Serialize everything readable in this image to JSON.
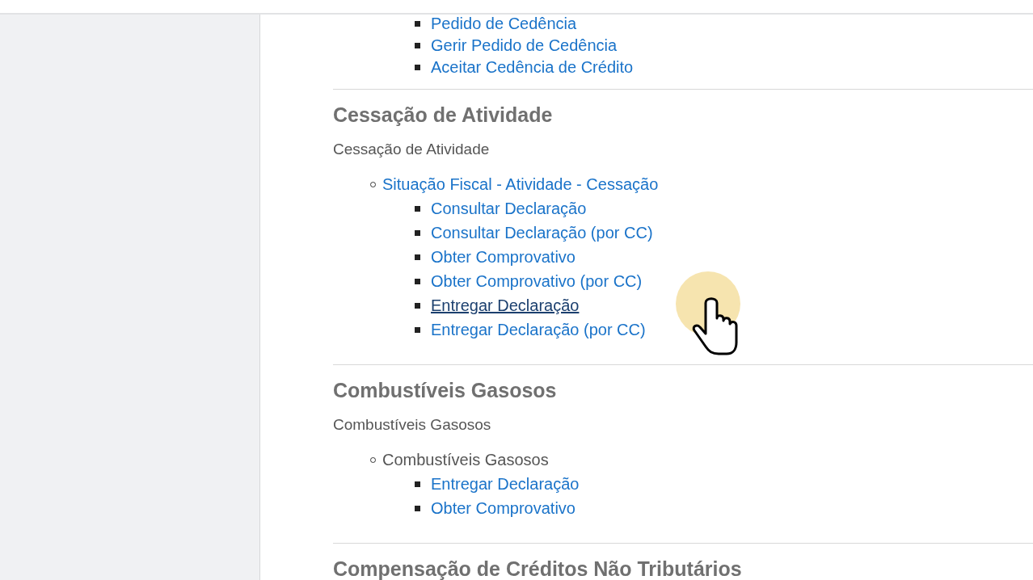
{
  "top_links": [
    {
      "label": "Pedido de Cedência",
      "hovered": false
    },
    {
      "label": "Gerir Pedido de Cedência",
      "hovered": false
    },
    {
      "label": "Aceitar Cedência de Crédito",
      "hovered": false
    }
  ],
  "sections": [
    {
      "title": "Cessação de Atividade",
      "description": "Cessação de Atividade",
      "groups": [
        {
          "label": "Situação Fiscal - Atividade - Cessação",
          "kind": "link",
          "items": [
            {
              "label": "Consultar Declaração",
              "hovered": false
            },
            {
              "label": "Consultar Declaração (por CC)",
              "hovered": false
            },
            {
              "label": "Obter Comprovativo",
              "hovered": false
            },
            {
              "label": "Obter Comprovativo (por CC)",
              "hovered": false
            },
            {
              "label": "Entregar Declaração",
              "hovered": true
            },
            {
              "label": "Entregar Declaração (por CC)",
              "hovered": false
            }
          ]
        }
      ]
    },
    {
      "title": "Combustíveis Gasosos",
      "description": "Combustíveis Gasosos",
      "groups": [
        {
          "label": "Combustíveis Gasosos",
          "kind": "text",
          "items": [
            {
              "label": "Entregar Declaração",
              "hovered": false
            },
            {
              "label": "Obter Comprovativo",
              "hovered": false
            }
          ]
        }
      ]
    },
    {
      "title": "Compensação de Créditos Não Tributários"
    }
  ]
}
